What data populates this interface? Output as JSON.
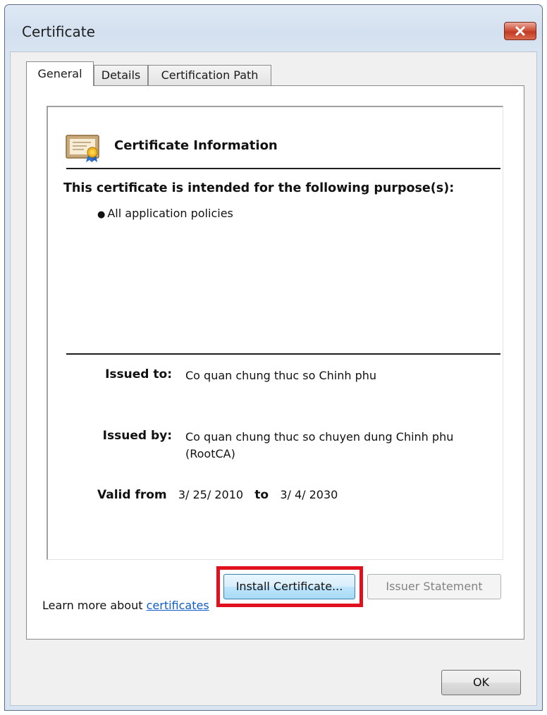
{
  "window": {
    "title": "Certificate",
    "close_icon": "close-x-icon"
  },
  "tabs": [
    {
      "label": "General",
      "active": true
    },
    {
      "label": "Details",
      "active": false
    },
    {
      "label": "Certification Path",
      "active": false
    }
  ],
  "general": {
    "icon": "certificate-icon",
    "heading": "Certificate Information",
    "purpose_title": "This certificate is intended for the following purpose(s):",
    "purposes": [
      "All application policies"
    ],
    "issued_to_label": "Issued to:",
    "issued_to_value": "Co quan chung thuc so Chinh phu",
    "issued_by_label": "Issued by:",
    "issued_by_value": "Co quan chung thuc so chuyen dung Chinh phu (RootCA)",
    "valid_from_label": "Valid from",
    "valid_from_value": "3/ 25/ 2010",
    "valid_to_label": "to",
    "valid_to_value": "3/ 4/ 2030"
  },
  "buttons": {
    "install": "Install Certificate...",
    "issuer_statement": "Issuer Statement",
    "issuer_statement_enabled": false,
    "ok": "OK"
  },
  "learn_more": {
    "prefix": "Learn more about",
    "link": "certificates"
  },
  "colors": {
    "highlight": "#e0101e",
    "link": "#0f5cc4",
    "close_button": "#c23a22"
  }
}
